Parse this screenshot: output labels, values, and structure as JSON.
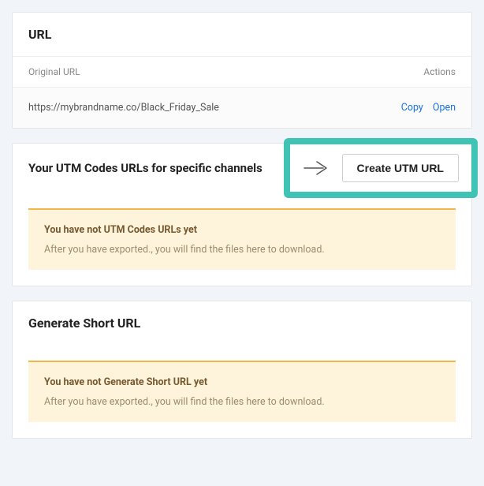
{
  "url_card": {
    "title": "URL",
    "columns": {
      "original": "Original URL",
      "actions": "Actions"
    },
    "row": {
      "url": "https://mybrandname.co/Black_Friday_Sale",
      "copy": "Copy",
      "open": "Open"
    }
  },
  "utm_card": {
    "title": "Your UTM Codes URLs for specific channels",
    "create_button": "Create UTM URL",
    "notice_title": "You have not UTM Codes URLs yet",
    "notice_text": "After you have exported., you will find the files here to download."
  },
  "short_card": {
    "title": "Generate Short URL",
    "notice_title": "You have not Generate Short URL yet",
    "notice_text": "After you have exported., you will find the files here to download."
  }
}
